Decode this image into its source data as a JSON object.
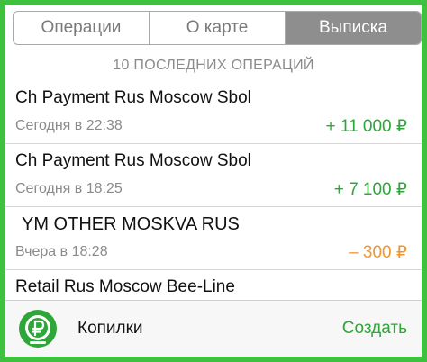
{
  "tabs": [
    {
      "label": "Операции",
      "active": false
    },
    {
      "label": "О карте",
      "active": false
    },
    {
      "label": "Выписка",
      "active": true
    }
  ],
  "section_title": "10 ПОСЛЕДНИХ ОПЕРАЦИЙ",
  "operations": [
    {
      "title": "Ch Payment Rus Moscow Sbol",
      "time": "Сегодня в 22:38",
      "amount": "+ 11 000 ₽",
      "amount_color": "#2fa63a"
    },
    {
      "title": "Ch Payment Rus Moscow Sbol",
      "time": "Сегодня в 18:25",
      "amount": "+ 7 100 ₽",
      "amount_color": "#2fa63a"
    },
    {
      "title": "YM OTHER MOSKVA RUS",
      "time": "Вчера в 18:28",
      "amount": "– 300 ₽",
      "amount_color": "#f0962e"
    },
    {
      "title": "Retail Rus Moscow Bee-Line"
    }
  ],
  "bottom_bar": {
    "icon": "piggy-bank-ruble-icon",
    "label": "Копилки",
    "action": "Создать"
  },
  "colors": {
    "accent_green": "#2fa63a",
    "frame_green": "#3ec13e",
    "expense_orange": "#f0962e",
    "active_tab": "#8e8e8e"
  }
}
